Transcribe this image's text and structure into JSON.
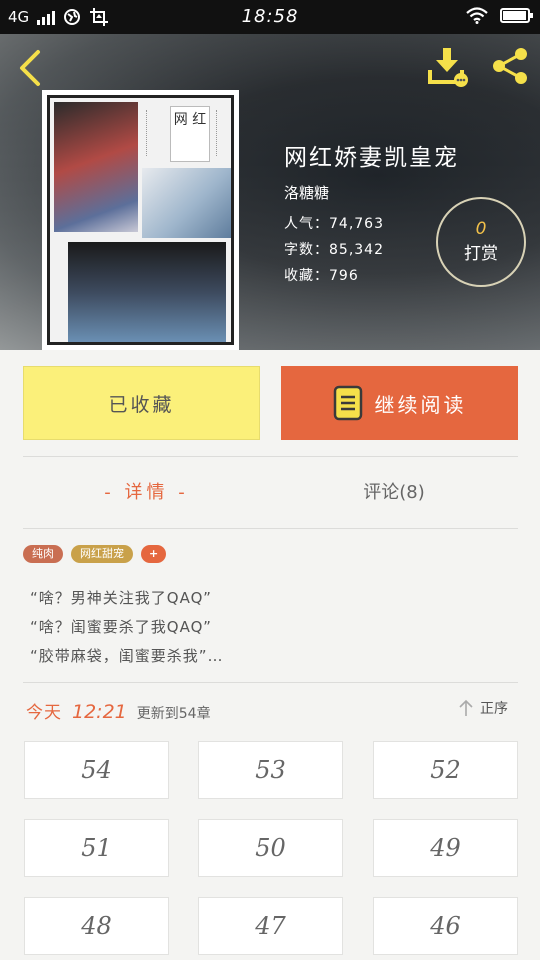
{
  "status_bar": {
    "network": "4G",
    "time": "18:58"
  },
  "book": {
    "title": "网红娇妻凯皇宠",
    "author": "洛糖糖",
    "popularity_label": "人气：",
    "popularity": "74,763",
    "wordcount_label": "字数：",
    "wordcount": "85,342",
    "favorites_label": "收藏：",
    "favorites": "796",
    "cover_text": "网 红"
  },
  "tip": {
    "count": "0",
    "label": "打赏"
  },
  "actions": {
    "collected_label": "已收藏",
    "continue_label": "继续阅读"
  },
  "tabs": {
    "detail": "- 详情 -",
    "comments": "评论(8)"
  },
  "tags": [
    "纯肉",
    "网红甜宠",
    "+"
  ],
  "summary": {
    "line1": "“啥？男神关注我了QAQ”",
    "line2": "“啥？闺蜜要杀了我QAQ”",
    "line3": "“胶带麻袋，闺蜜要杀我”…"
  },
  "update": {
    "today": "今天",
    "time": "12:21",
    "text": "更新到54章",
    "sort_label": "正序"
  },
  "chapters": [
    "54",
    "53",
    "52",
    "51",
    "50",
    "49",
    "48",
    "47",
    "46"
  ],
  "colors": {
    "accent": "#e5673f",
    "collected_bg": "#fbf07a",
    "icon_yellow": "#f5e04a"
  }
}
